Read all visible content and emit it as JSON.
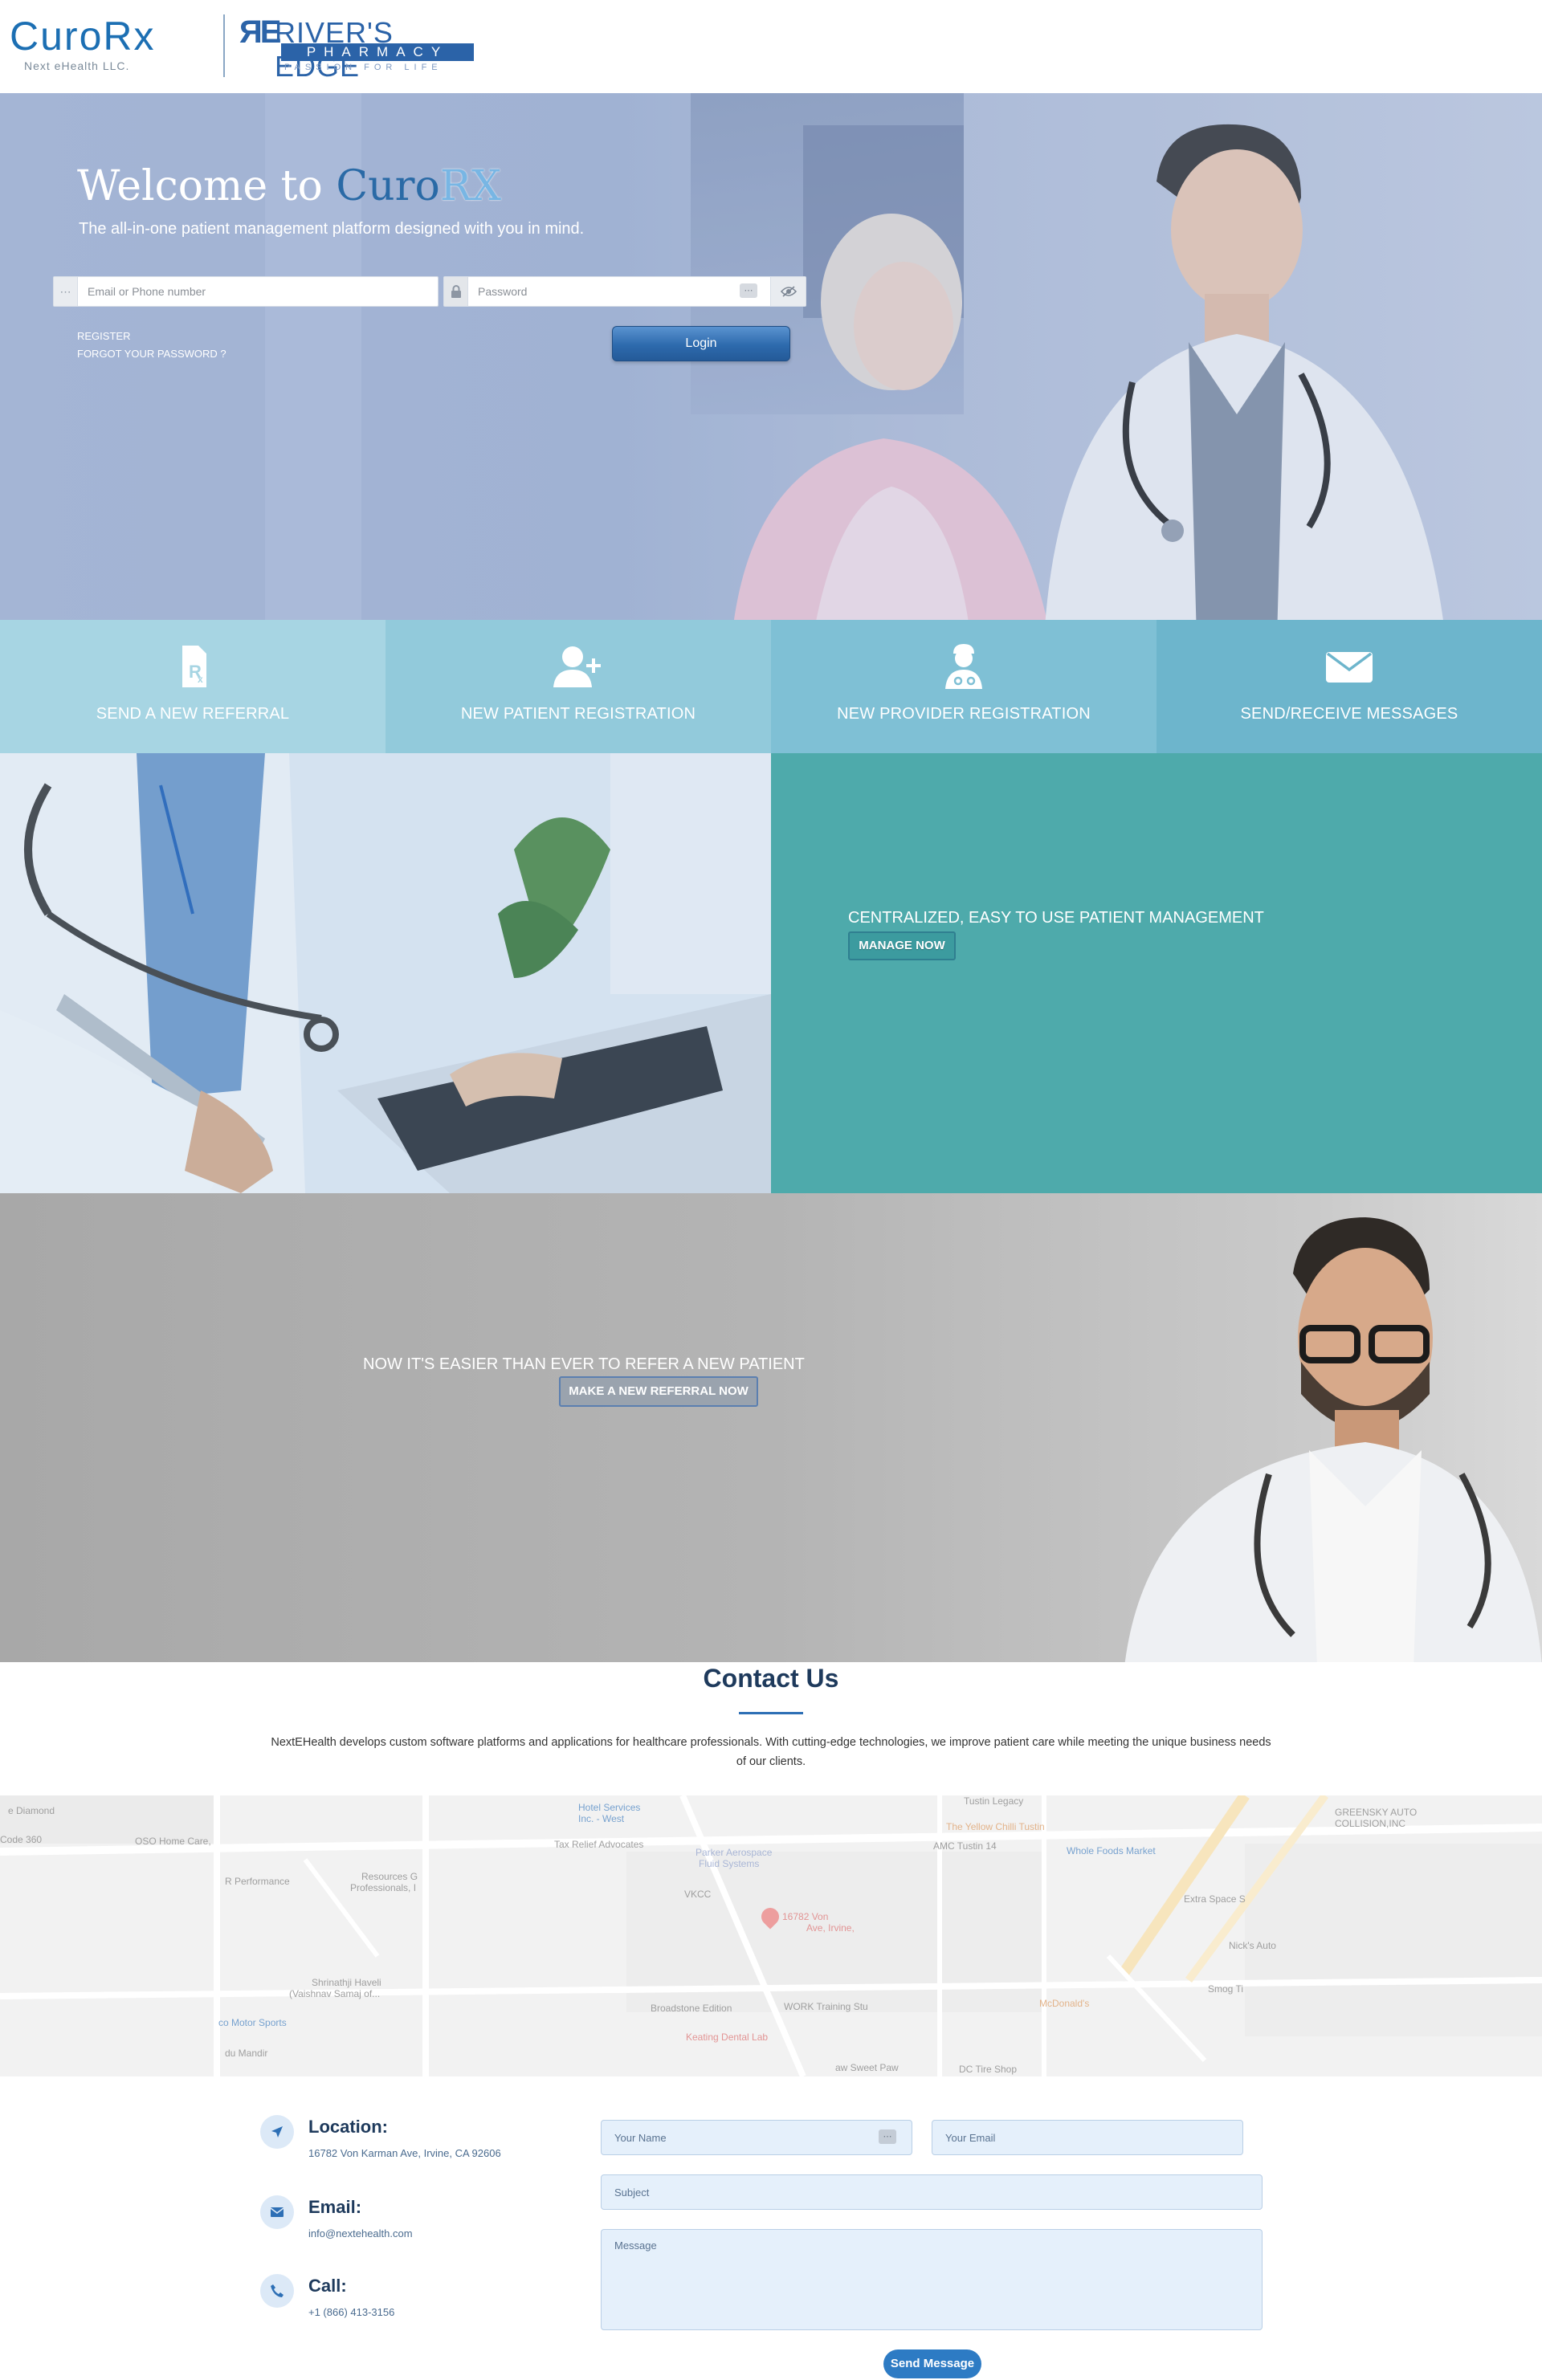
{
  "header": {
    "curo_logo": "CuroRx",
    "curo_sub": "Next eHealth LLC.",
    "rivers_logo": "RIVER'S EDGE",
    "rivers_bar": "PHARMACY",
    "rivers_tag": "PASSION FOR LIFE"
  },
  "hero": {
    "welcome_prefix": "Welcome to ",
    "welcome_brand": "Curo",
    "welcome_rx": "RX",
    "tagline": "The all-in-one patient management platform designed with you in mind.",
    "email_placeholder": "Email or Phone number",
    "password_placeholder": "Password",
    "register_link": "REGISTER",
    "forgot_link": "FORGOT YOUR PASSWORD ?",
    "login_button": "Login"
  },
  "tiles": [
    {
      "label": "SEND A NEW REFERRAL",
      "icon": "prescription-icon",
      "color": "#a7d5e3"
    },
    {
      "label": "NEW PATIENT REGISTRATION",
      "icon": "add-user-icon",
      "color": "#92cadb"
    },
    {
      "label": "NEW PROVIDER REGISTRATION",
      "icon": "doctor-icon",
      "color": "#7fc0d5"
    },
    {
      "label": "SEND/RECEIVE MESSAGES",
      "icon": "envelope-icon",
      "color": "#6db5cc"
    }
  ],
  "section_manage": {
    "headline": "CENTRALIZED, EASY TO USE PATIENT MANAGEMENT",
    "button": "MANAGE NOW"
  },
  "section_referral": {
    "headline": "NOW IT'S EASIER THAN EVER TO REFER A NEW PATIENT",
    "button": "MAKE A NEW REFERRAL NOW"
  },
  "contact": {
    "title": "Contact Us",
    "description": "NextEHealth develops custom software platforms and applications for healthcare professionals. With cutting-edge technologies, we improve patient care while meeting the unique business needs of our clients.",
    "location_label": "Location:",
    "location_value": "16782 Von Karman Ave, Irvine, CA 92606",
    "email_label": "Email:",
    "email_value": "info@nextehealth.com",
    "call_label": "Call:",
    "call_value": "+1 (866) 413-3156"
  },
  "map": {
    "labels": [
      "e Diamond",
      "Code 360",
      "OSO Home Care,",
      "R Performance",
      "Resources G",
      "Professionals, I",
      "Hotel Services",
      "Inc. - West",
      "Tax Relief Advocates",
      "Parker Aerospace",
      "Fluid Systems",
      "VKCC",
      "16782 Von",
      "Ave, Irvine,",
      "Tustin Legacy",
      "The Yellow Chilli Tustin",
      "AMC Tustin 14",
      "Whole Foods Market",
      "Extra Space S",
      "Nick's Auto",
      "Shrinathji Haveli",
      "(Vaishnav Samaj of...",
      "co Motor Sports",
      "du Mandir",
      "Broadstone Edition",
      "WORK Training Stu",
      "Keating Dental Lab",
      "McDonald's",
      "aw Sweet Paw",
      "DC Tire Shop",
      "GREENSKY AUTO",
      "COLLISION,INC",
      "Smog Ti"
    ]
  },
  "form": {
    "name_placeholder": "Your Name",
    "email_placeholder": "Your Email",
    "subject_placeholder": "Subject",
    "message_placeholder": "Message",
    "send_button": "Send Message"
  }
}
